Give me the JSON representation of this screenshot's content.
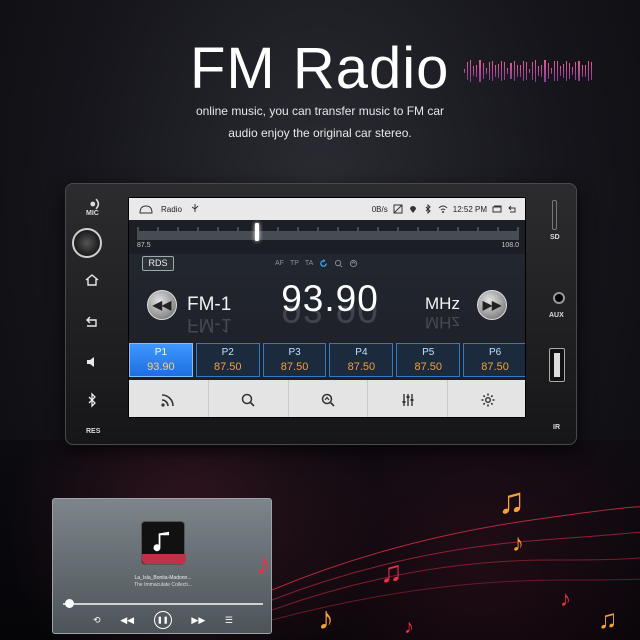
{
  "hero": {
    "title": "FM Radio",
    "subtitle_line1": "online music, you can transfer music to FM car",
    "subtitle_line2": "audio enjoy the original car stereo."
  },
  "unit": {
    "labels": {
      "mic": "MIC",
      "res": "RES",
      "sd": "SD",
      "aux": "AUX",
      "ir": "IR"
    }
  },
  "statusbar": {
    "app_name": "Radio",
    "data_rate": "0B/s",
    "time": "12:52 PM"
  },
  "tuner": {
    "min": "87.5",
    "max": "108.0",
    "needle_fraction": 0.31
  },
  "radio": {
    "rds_label": "RDS",
    "flags": [
      "AF",
      "TP",
      "TA"
    ],
    "band": "FM-1",
    "frequency": "93.90",
    "unit": "MHz"
  },
  "presets": [
    {
      "name": "P1",
      "freq": "93.90",
      "active": true
    },
    {
      "name": "P2",
      "freq": "87.50",
      "active": false
    },
    {
      "name": "P3",
      "freq": "87.50",
      "active": false
    },
    {
      "name": "P4",
      "freq": "87.50",
      "active": false
    },
    {
      "name": "P5",
      "freq": "87.50",
      "active": false
    },
    {
      "name": "P6",
      "freq": "87.50",
      "active": false
    }
  ],
  "toolbar": [
    "broadcast-icon",
    "search-icon",
    "scan-icon",
    "equalizer-icon",
    "settings-icon"
  ],
  "player": {
    "song": "La_Isla_Bonita-Madonn...",
    "album": "The Immaculate Collecti...",
    "progress": 0.03
  },
  "colors": {
    "accent_blue": "#3f97ff",
    "preset_freq": "#f5a03a",
    "note_orange": "#f5a03a",
    "note_red": "#e8304a"
  }
}
